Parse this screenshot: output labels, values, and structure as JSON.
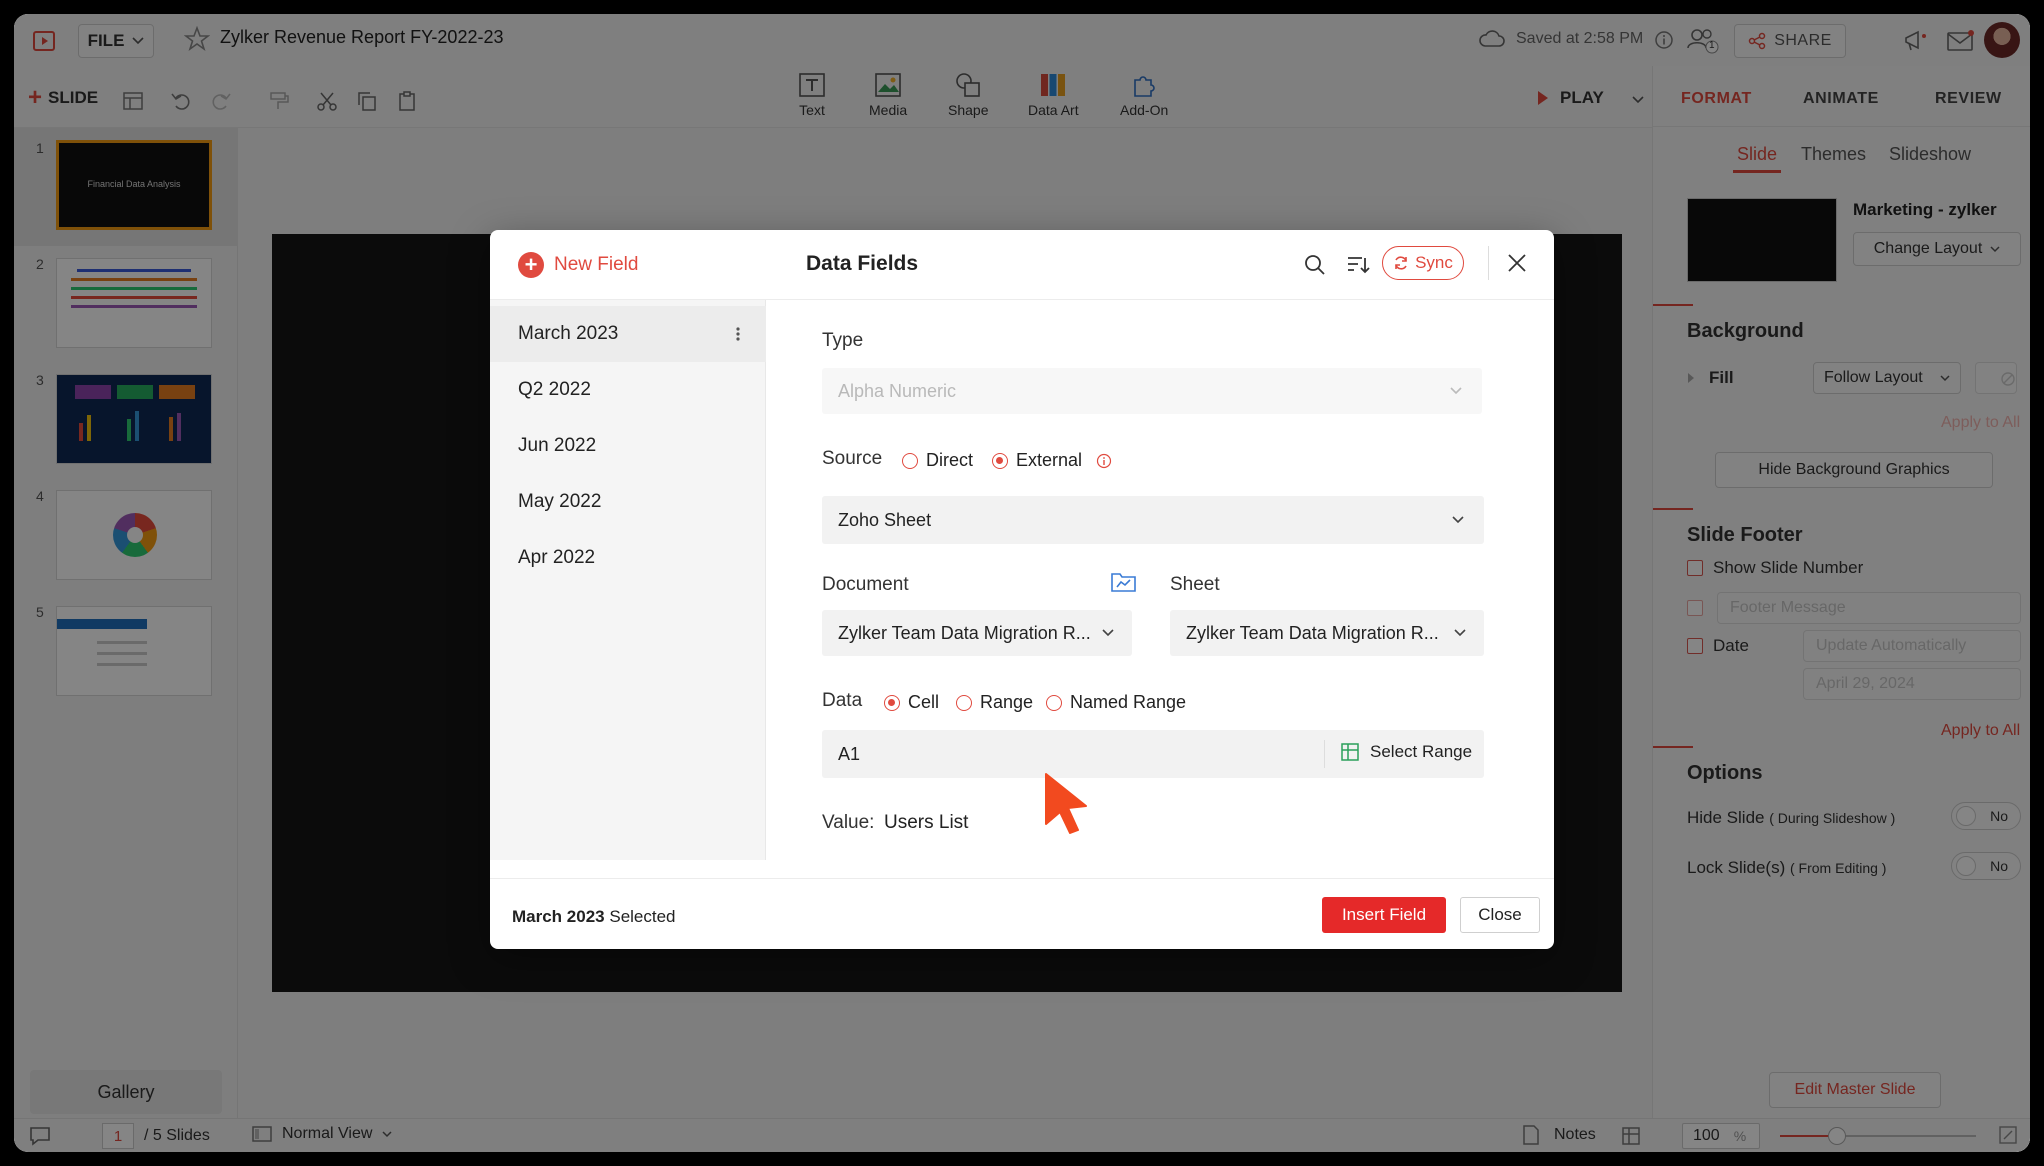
{
  "app": {
    "file_label": "FILE",
    "doc_title": "Zylker Revenue Report FY-2022-23",
    "saved_status": "Saved at 2:58 PM",
    "collab_count": "1",
    "share_label": "SHARE"
  },
  "toolbar": {
    "slide_label": "SLIDE",
    "insert_items": [
      {
        "label": "Text",
        "icon": "text-icon"
      },
      {
        "label": "Media",
        "icon": "media-icon"
      },
      {
        "label": "Shape",
        "icon": "shape-icon"
      },
      {
        "label": "Data Art",
        "icon": "data-art-icon"
      },
      {
        "label": "Add-On",
        "icon": "add-on-icon"
      }
    ],
    "play_label": "PLAY"
  },
  "right_panel": {
    "tabs": [
      "FORMAT",
      "ANIMATE",
      "REVIEW"
    ],
    "active_tab": "FORMAT",
    "subtabs": [
      "Slide",
      "Themes",
      "Slideshow"
    ],
    "active_subtab": "Slide",
    "layout_name": "Marketing - zylker",
    "change_layout_label": "Change Layout",
    "background": {
      "title": "Background",
      "fill_label": "Fill",
      "fill_value": "Follow Layout",
      "apply_all": "Apply to All",
      "hide_graphics": "Hide Background Graphics"
    },
    "footer": {
      "title": "Slide Footer",
      "show_number": "Show Slide Number",
      "footer_placeholder": "Footer Message",
      "date_label": "Date",
      "date_mode": "Update Automatically",
      "date_value": "April 29, 2024",
      "apply_all": "Apply to All"
    },
    "options": {
      "title": "Options",
      "hide_slide": "Hide Slide",
      "hide_slide_note": "( During Slideshow )",
      "lock_slide": "Lock Slide(s)",
      "lock_slide_note": "( From Editing )",
      "toggle_value": "No"
    },
    "edit_master": "Edit Master Slide",
    "zoom": "100",
    "zoom_unit": "%"
  },
  "slides_panel": {
    "numbers": [
      "1",
      "2",
      "3",
      "4",
      "5"
    ],
    "thumb1_title": "Financial Data Analysis",
    "gallery_label": "Gallery"
  },
  "status_bar": {
    "page": "1",
    "total": "/ 5 Slides",
    "view": "Normal View",
    "notes": "Notes"
  },
  "modal": {
    "new_field": "New Field",
    "title": "Data Fields",
    "sync_label": "Sync",
    "fields": [
      "March 2023",
      "Q2 2022",
      "Jun 2022",
      "May 2022",
      "Apr 2022"
    ],
    "type_label": "Type",
    "type_value": "Alpha Numeric",
    "source_label": "Source",
    "source_direct": "Direct",
    "source_external": "External",
    "source_value": "Zoho Sheet",
    "document_label": "Document",
    "document_value": "Zylker Team Data Migration R...",
    "sheet_label": "Sheet",
    "sheet_value": "Zylker Team Data Migration R...",
    "data_label": "Data",
    "data_cell": "Cell",
    "data_range": "Range",
    "data_named": "Named Range",
    "cell_value": "A1",
    "select_range": "Select Range",
    "value_label": "Value:",
    "value_text": "Users List",
    "selected_name": "March 2023",
    "selected_suffix": "Selected",
    "insert_label": "Insert Field",
    "close_label": "Close"
  },
  "colors": {
    "accent": "#e04a3f",
    "insert_button": "#e52929"
  }
}
